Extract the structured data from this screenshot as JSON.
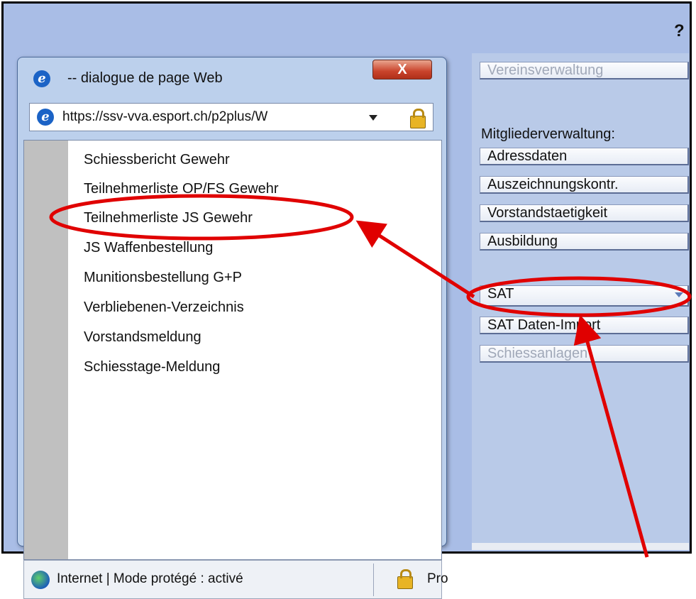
{
  "window": {
    "help_label": "?"
  },
  "dialog": {
    "title": "-- dialogue de page Web",
    "close_label": "X",
    "address_url": "https://ssv-vva.esport.ch/p2plus/W",
    "menu_items": [
      "Schiessbericht Gewehr",
      "Teilnehmerliste OP/FS Gewehr",
      "Teilnehmerliste JS Gewehr",
      "JS Waffenbestellung",
      "Munitionsbestellung G+P",
      "Verbliebenen-Verzeichnis",
      "Vorstandsmeldung",
      "Schiesstage-Meldung"
    ],
    "status_text": "Internet | Mode protégé : activé",
    "status_right": "Pro"
  },
  "panel": {
    "vereinsverwaltung": "Vereinsverwaltung",
    "section_label": "Mitgliederverwaltung:",
    "buttons": [
      "Adressdaten",
      "Auszeichnungskontr.",
      "Vorstandstaetigkeit",
      "Ausbildung"
    ],
    "sat": "SAT",
    "sat_import": "SAT Daten-Import",
    "schiessanlagen": "Schiessanlagen"
  },
  "colors": {
    "annotation": "#e00000",
    "window_bg": "#a9bde6",
    "dialog_frame": "#bcd0ec"
  }
}
